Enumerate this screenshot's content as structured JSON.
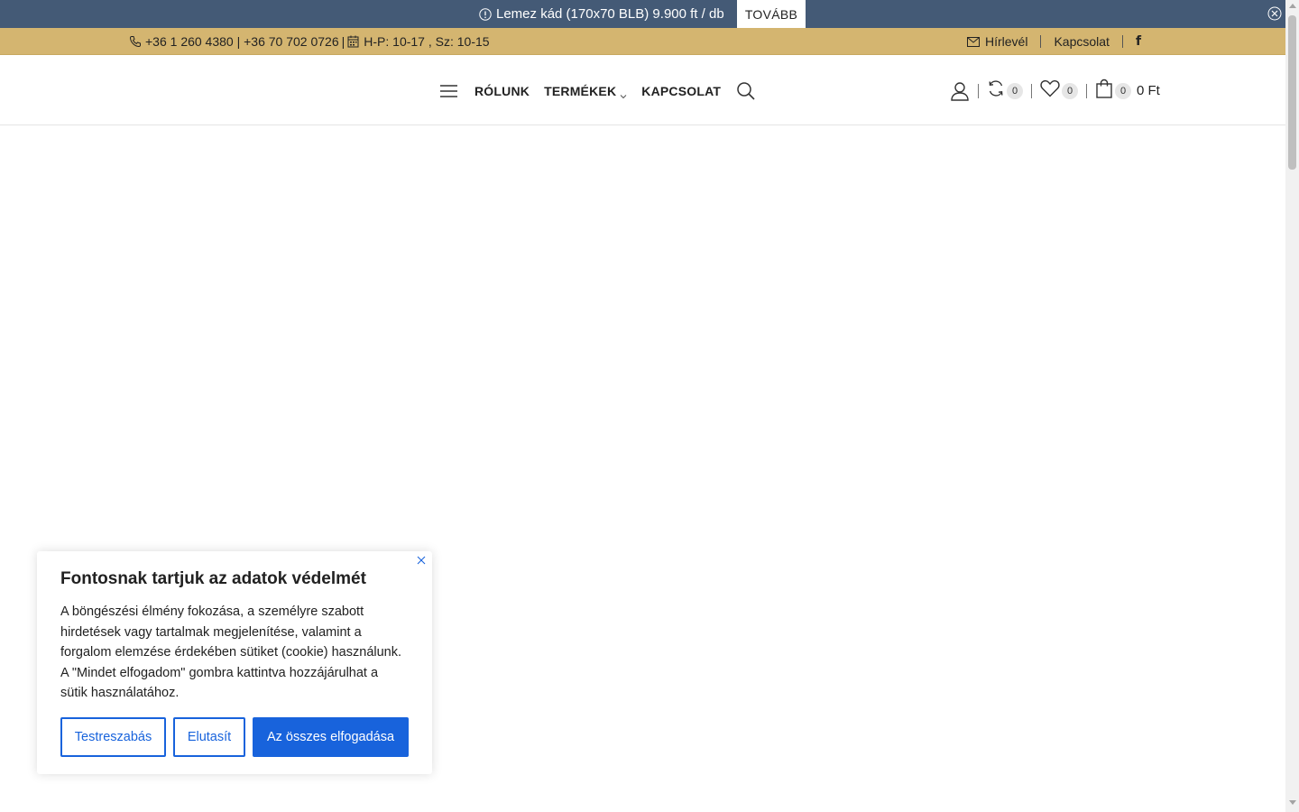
{
  "announcement": {
    "message": "Lemez kád (170x70 BLB) 9.900 ft / db",
    "more_label": "TOVÁBB"
  },
  "topbar": {
    "phones": "+36 1 260 4380 | +36 70 702 0726",
    "hours": "H-P: 10-17 , Sz: 10-15",
    "newsletter_label": "Hírlevél",
    "contact_label": "Kapcsolat",
    "facebook_label": "f"
  },
  "nav": {
    "items": [
      "RÓLUNK",
      "TERMÉKEK",
      "KAPCSOLAT"
    ]
  },
  "header_icons": {
    "compare_count": "0",
    "wishlist_count": "0",
    "cart_count": "0",
    "cart_total": "0 Ft"
  },
  "cookie": {
    "title": "Fontosnak tartjuk az adatok védelmét",
    "body": "A böngészési élmény fokozása, a személyre szabott hirdetések vagy tartalmak megjelenítése, valamint a forgalom elemzése érdekében sütiket (cookie) használunk. A \"Mindet elfogadom\" gombra kattintva hozzájárulhat a sütik használatához.",
    "customize_label": "Testreszabás",
    "reject_label": "Elutasít",
    "accept_all_label": "Az összes elfogadása"
  },
  "colors": {
    "announcement_bg": "#445a76",
    "topbar_bg": "#d4b570",
    "cookie_accent": "#1863dc"
  }
}
